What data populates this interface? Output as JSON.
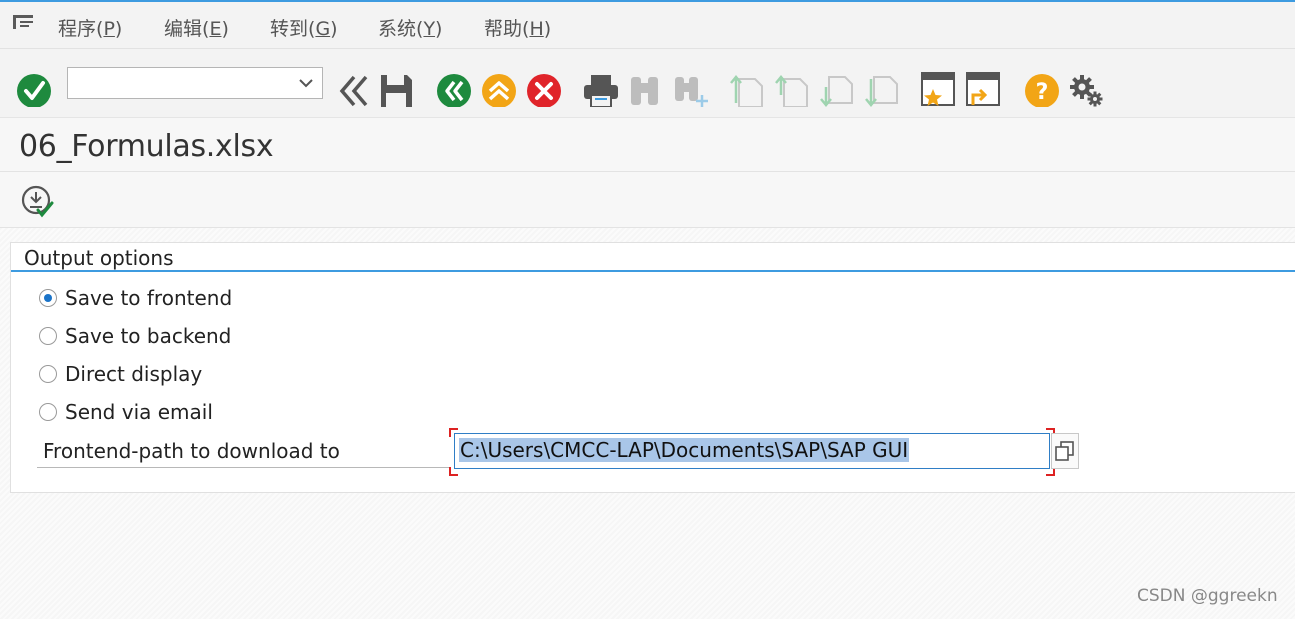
{
  "menu": {
    "items": [
      {
        "label": "程序",
        "key": "P"
      },
      {
        "label": "编辑",
        "key": "E"
      },
      {
        "label": "转到",
        "key": "G"
      },
      {
        "label": "系统",
        "key": "Y"
      },
      {
        "label": "帮助",
        "key": "H"
      }
    ]
  },
  "toolbar": {
    "command_field_value": "",
    "icons": [
      "enter-icon",
      "command-field",
      "back-double-chevron-icon",
      "save-icon",
      "back-icon",
      "exit-icon",
      "cancel-icon",
      "print-icon",
      "find-icon",
      "find-next-icon",
      "first-page-icon",
      "previous-page-icon",
      "next-page-icon",
      "last-page-icon",
      "create-session-icon",
      "create-shortcut-icon",
      "help-icon",
      "settings-gear-icon"
    ]
  },
  "title": "06_Formulas.xlsx",
  "app_toolbar": {
    "icons": [
      "execute-icon"
    ]
  },
  "output_options": {
    "title": "Output options",
    "options": [
      {
        "label": "Save to frontend",
        "checked": true
      },
      {
        "label": "Save to backend",
        "checked": false
      },
      {
        "label": "Direct display",
        "checked": false
      },
      {
        "label": "Send via email",
        "checked": false
      }
    ],
    "path_label": "Frontend-path to download to",
    "path_value": "C:\\Users\\CMCC-LAP\\Documents\\SAP\\SAP GUI"
  },
  "watermark": "CSDN @ggreekn",
  "colors": {
    "accent_blue": "#3d9be0",
    "green": "#1e8a3e",
    "orange": "#f2a516",
    "red": "#e0242a",
    "selection": "#a9c6e8"
  }
}
